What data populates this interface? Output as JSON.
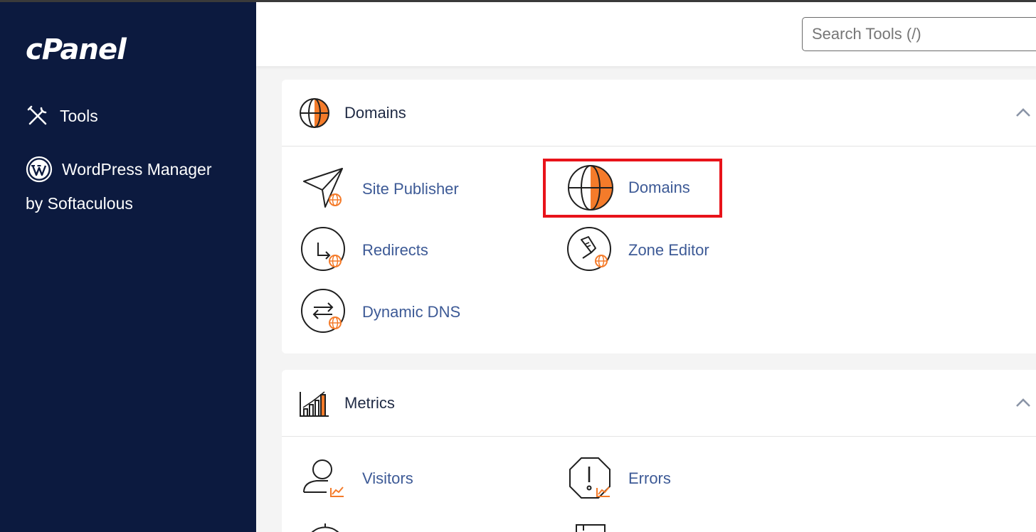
{
  "sidebar": {
    "logo": "cPanel",
    "items": [
      {
        "label": "Tools",
        "icon": "tools-icon"
      },
      {
        "label": "WordPress Manager",
        "sublabel": "by Softaculous",
        "icon": "wordpress-icon"
      }
    ]
  },
  "header": {
    "search_placeholder": "Search Tools (/)"
  },
  "sections": [
    {
      "title": "Domains",
      "icon": "globe-icon",
      "items": [
        {
          "label": "Site Publisher",
          "icon": "paper-plane-icon"
        },
        {
          "label": "Domains",
          "icon": "globe-icon"
        },
        {
          "label": "Redirects",
          "icon": "redirect-icon"
        },
        {
          "label": "Zone Editor",
          "icon": "zone-editor-icon"
        },
        {
          "label": "Dynamic DNS",
          "icon": "dynamic-dns-icon"
        }
      ]
    },
    {
      "title": "Metrics",
      "icon": "bar-chart-icon",
      "items": [
        {
          "label": "Visitors",
          "icon": "visitors-icon"
        },
        {
          "label": "Errors",
          "icon": "errors-icon"
        }
      ]
    }
  ],
  "colors": {
    "sidebar_bg": "#0c1a3f",
    "link": "#3d5a96",
    "accent": "#f47b2a",
    "highlight": "#e8131a"
  }
}
